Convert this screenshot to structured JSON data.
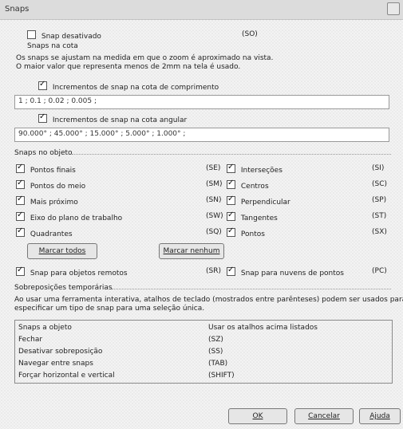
{
  "window": {
    "title": "Snaps"
  },
  "snap_off": {
    "label": "Snap desativado",
    "shortcut": "(SO)",
    "checked": false
  },
  "elevation": {
    "header": "Snaps na cota",
    "desc_line1": "Os snaps se ajustam na medida em que o zoom é aproximado na vista.",
    "desc_line2": "O maior valor que representa menos de 2mm na tela é usado.",
    "length_label": "Incrementos de snap na cota de comprimento",
    "length_checked": true,
    "length_value": "1 ; 0.1 ; 0.02 ; 0.005 ;",
    "angular_label": "Incrementos de snap na cota angular",
    "angular_checked": true,
    "angular_value": "90.000° ; 45.000° ; 15.000° ; 5.000° ; 1.000° ;"
  },
  "object_snaps": {
    "header": "Snaps no objeto",
    "left": [
      {
        "label": "Pontos finais",
        "shortcut": "(SE)",
        "checked": true
      },
      {
        "label": "Pontos do meio",
        "shortcut": "(SM)",
        "checked": true
      },
      {
        "label": "Mais próximo",
        "shortcut": "(SN)",
        "checked": true
      },
      {
        "label": "Eixo do plano de trabalho",
        "shortcut": "(SW)",
        "checked": true
      },
      {
        "label": "Quadrantes",
        "shortcut": "(SQ)",
        "checked": true
      }
    ],
    "right": [
      {
        "label": "Interseções",
        "shortcut": "(SI)",
        "checked": true
      },
      {
        "label": "Centros",
        "shortcut": "(SC)",
        "checked": true
      },
      {
        "label": "Perpendicular",
        "shortcut": "(SP)",
        "checked": true
      },
      {
        "label": "Tangentes",
        "shortcut": "(ST)",
        "checked": true
      },
      {
        "label": "Pontos",
        "shortcut": "(SX)",
        "checked": true
      }
    ],
    "mark_all": "Marcar todos",
    "mark_none": "Marcar nenhum",
    "remote_label": "Snap para objetos remotos",
    "remote_shortcut": "(SR)",
    "remote_checked": true,
    "cloud_label": "Snap para nuvens de pontos",
    "cloud_shortcut": "(PC)",
    "cloud_checked": true
  },
  "overrides": {
    "header": "Sobreposições temporárias",
    "desc_line1": "Ao usar uma ferramenta interativa, atalhos de teclado (mostrados entre parênteses) podem ser usados para",
    "desc_line2": "especificar um tipo de snap para uma seleção única.",
    "rows": [
      {
        "name": "Snaps a objeto",
        "value": "Usar os atalhos acima listados"
      },
      {
        "name": "Fechar",
        "value": "(SZ)"
      },
      {
        "name": "Desativar sobreposição",
        "value": "(SS)"
      },
      {
        "name": "Navegar entre snaps",
        "value": "(TAB)"
      },
      {
        "name": "Forçar horizontal e vertical",
        "value": "(SHIFT)"
      }
    ]
  },
  "footer": {
    "ok": "OK",
    "cancel": "Cancelar",
    "help": "Ajuda"
  }
}
